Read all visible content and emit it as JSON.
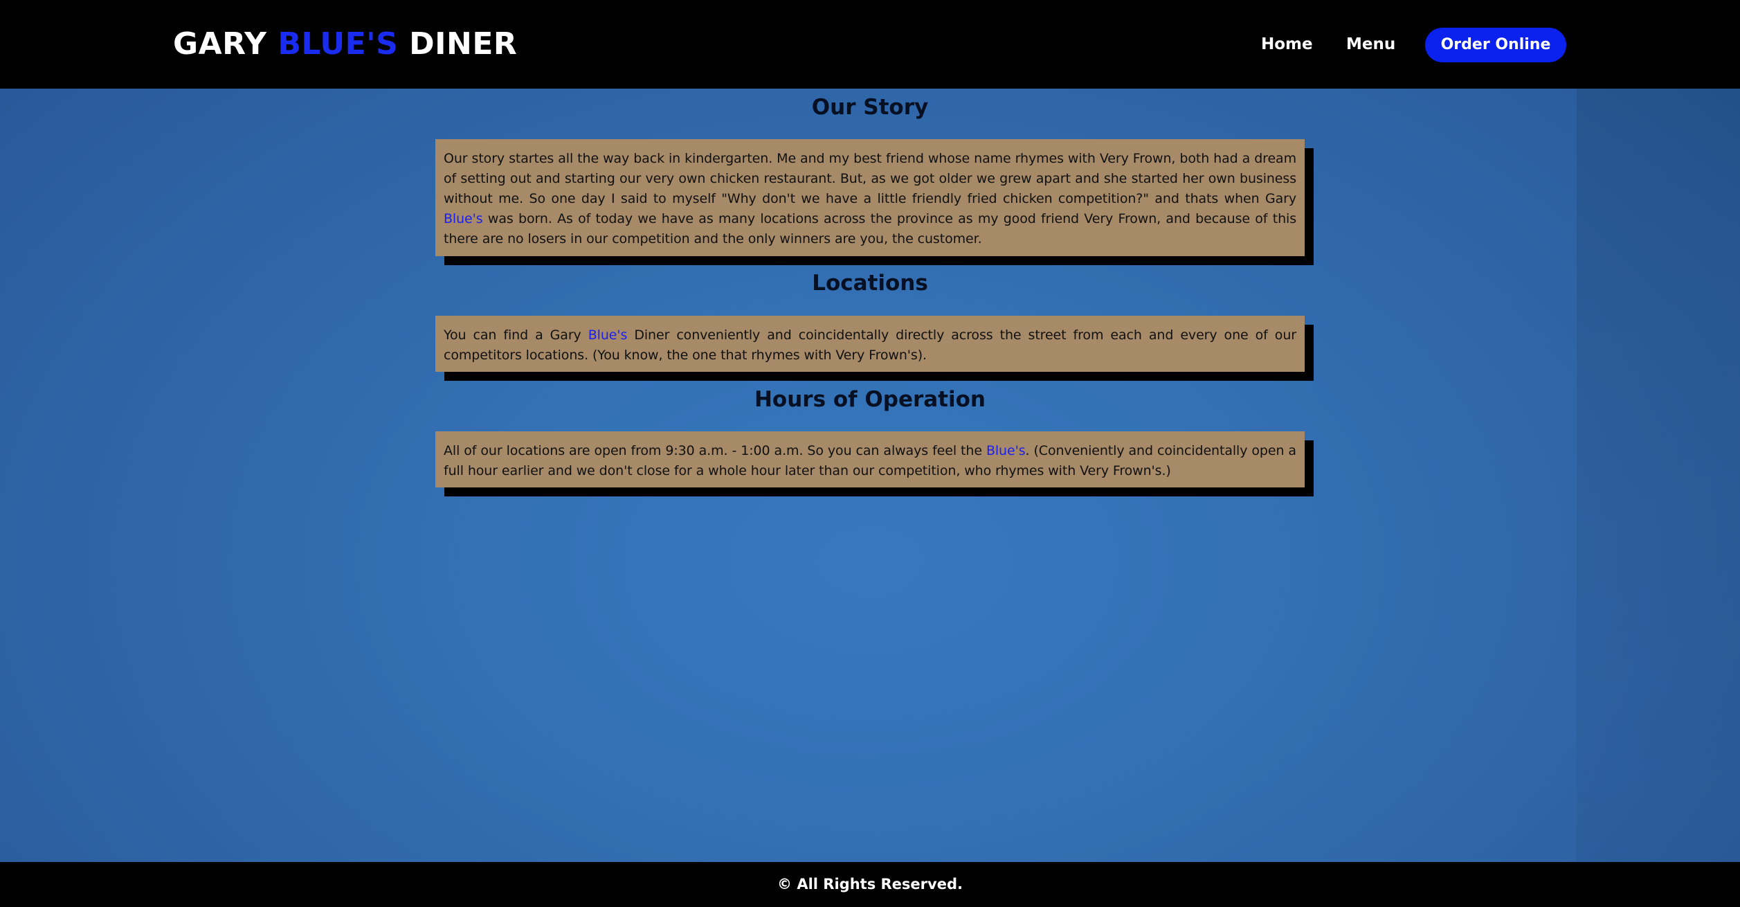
{
  "brand": {
    "part1": "GARY ",
    "accent": "BLUE'S",
    "part2": " DINER",
    "accent_color": "#1a2cf0"
  },
  "nav": {
    "home_label": "Home",
    "menu_label": "Menu",
    "order_label": "Order Online",
    "order_color": "#0b21ee"
  },
  "sections": {
    "story": {
      "title": "Our Story",
      "text_before": "Our story startes all the way back in kindergarten. Me and my best friend whose name rhymes with Very Frown, both had a dream of setting out and starting our very own chicken restaurant. But, as we got older we grew apart and she started her own business without me. So one day I said to myself \"Why don't we have a little friendly fried chicken competition?\" and thats when Gary ",
      "highlight": "Blue's",
      "text_after": " was born. As of today we have as many locations across the province as my good friend Very Frown, and because of this there are no losers in our competition and the only winners are you, the customer."
    },
    "locations": {
      "title": "Locations",
      "text_before": "You can find a Gary ",
      "highlight": "Blue's",
      "text_after": " Diner conveniently and coincidentally directly across the street from each and every one of our competitors locations. (You know, the one that rhymes with Very Frown's)."
    },
    "hours": {
      "title": "Hours of Operation",
      "text_before": "All of our locations are open from 9:30 a.m. - 1:00 a.m. So you can always feel the ",
      "highlight": "Blue's",
      "text_after": ". (Conveniently and coincidentally open a full hour earlier and we don't close for a whole hour later than our competition, who rhymes with Very Frown's.)"
    }
  },
  "footer": {
    "text": "© All Rights Reserved."
  },
  "colors": {
    "card_background": "#a78a67",
    "page_background": "#3471b5",
    "highlight_text": "#1a1ff0"
  }
}
